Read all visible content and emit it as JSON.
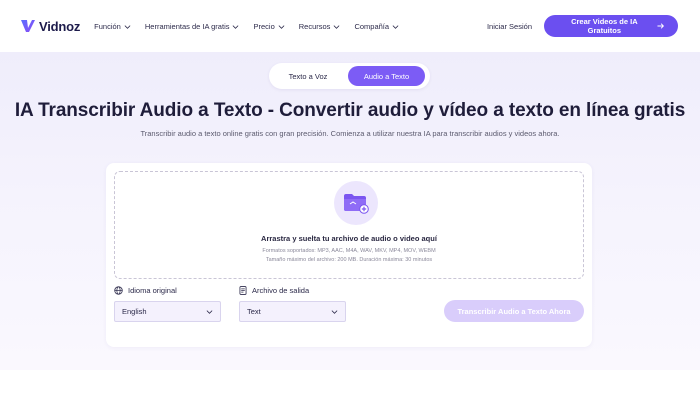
{
  "header": {
    "logo_text": "Vidnoz",
    "nav": [
      {
        "label": "Función"
      },
      {
        "label": "Herramientas de IA gratis"
      },
      {
        "label": "Precio"
      },
      {
        "label": "Recursos"
      },
      {
        "label": "Compañía"
      }
    ],
    "login_label": "Iniciar Sesión",
    "cta_label": "Crear Videos de IA Gratuitos",
    "cta_icon": "arrow-right-icon"
  },
  "tabs": [
    {
      "label": "Texto a Voz",
      "active": false
    },
    {
      "label": "Audio a Texto",
      "active": true
    }
  ],
  "hero": {
    "title": "IA Transcribir Audio a Texto - Convertir audio y vídeo a texto en línea gratis",
    "subtitle": "Transcribir audio a texto online gratis con gran precisión. Comienza a utilizar nuestra IA para transcribir audios y videos ahora."
  },
  "upload": {
    "icon": "folder-add-icon",
    "title": "Arrastra y suelta tu archivo de audio o video aquí",
    "formats": "Formatos soportados: MP3, AAC, M4A, WAV, MKV, MP4, MOV, WEBM",
    "max_size": "Tamaño máximo del archivo: 200 MB. Duración máxima: 30 minutos"
  },
  "options": {
    "language_label": "Idioma original",
    "language_value": "English",
    "output_label": "Archivo de salida",
    "output_value": "Text",
    "submit_label": "Transcribir Audio a Texto Ahora"
  },
  "colors": {
    "accent": "#6b4ff0",
    "tab_active": "#7c5cf5",
    "disabled_button": "#d9cdfb"
  }
}
